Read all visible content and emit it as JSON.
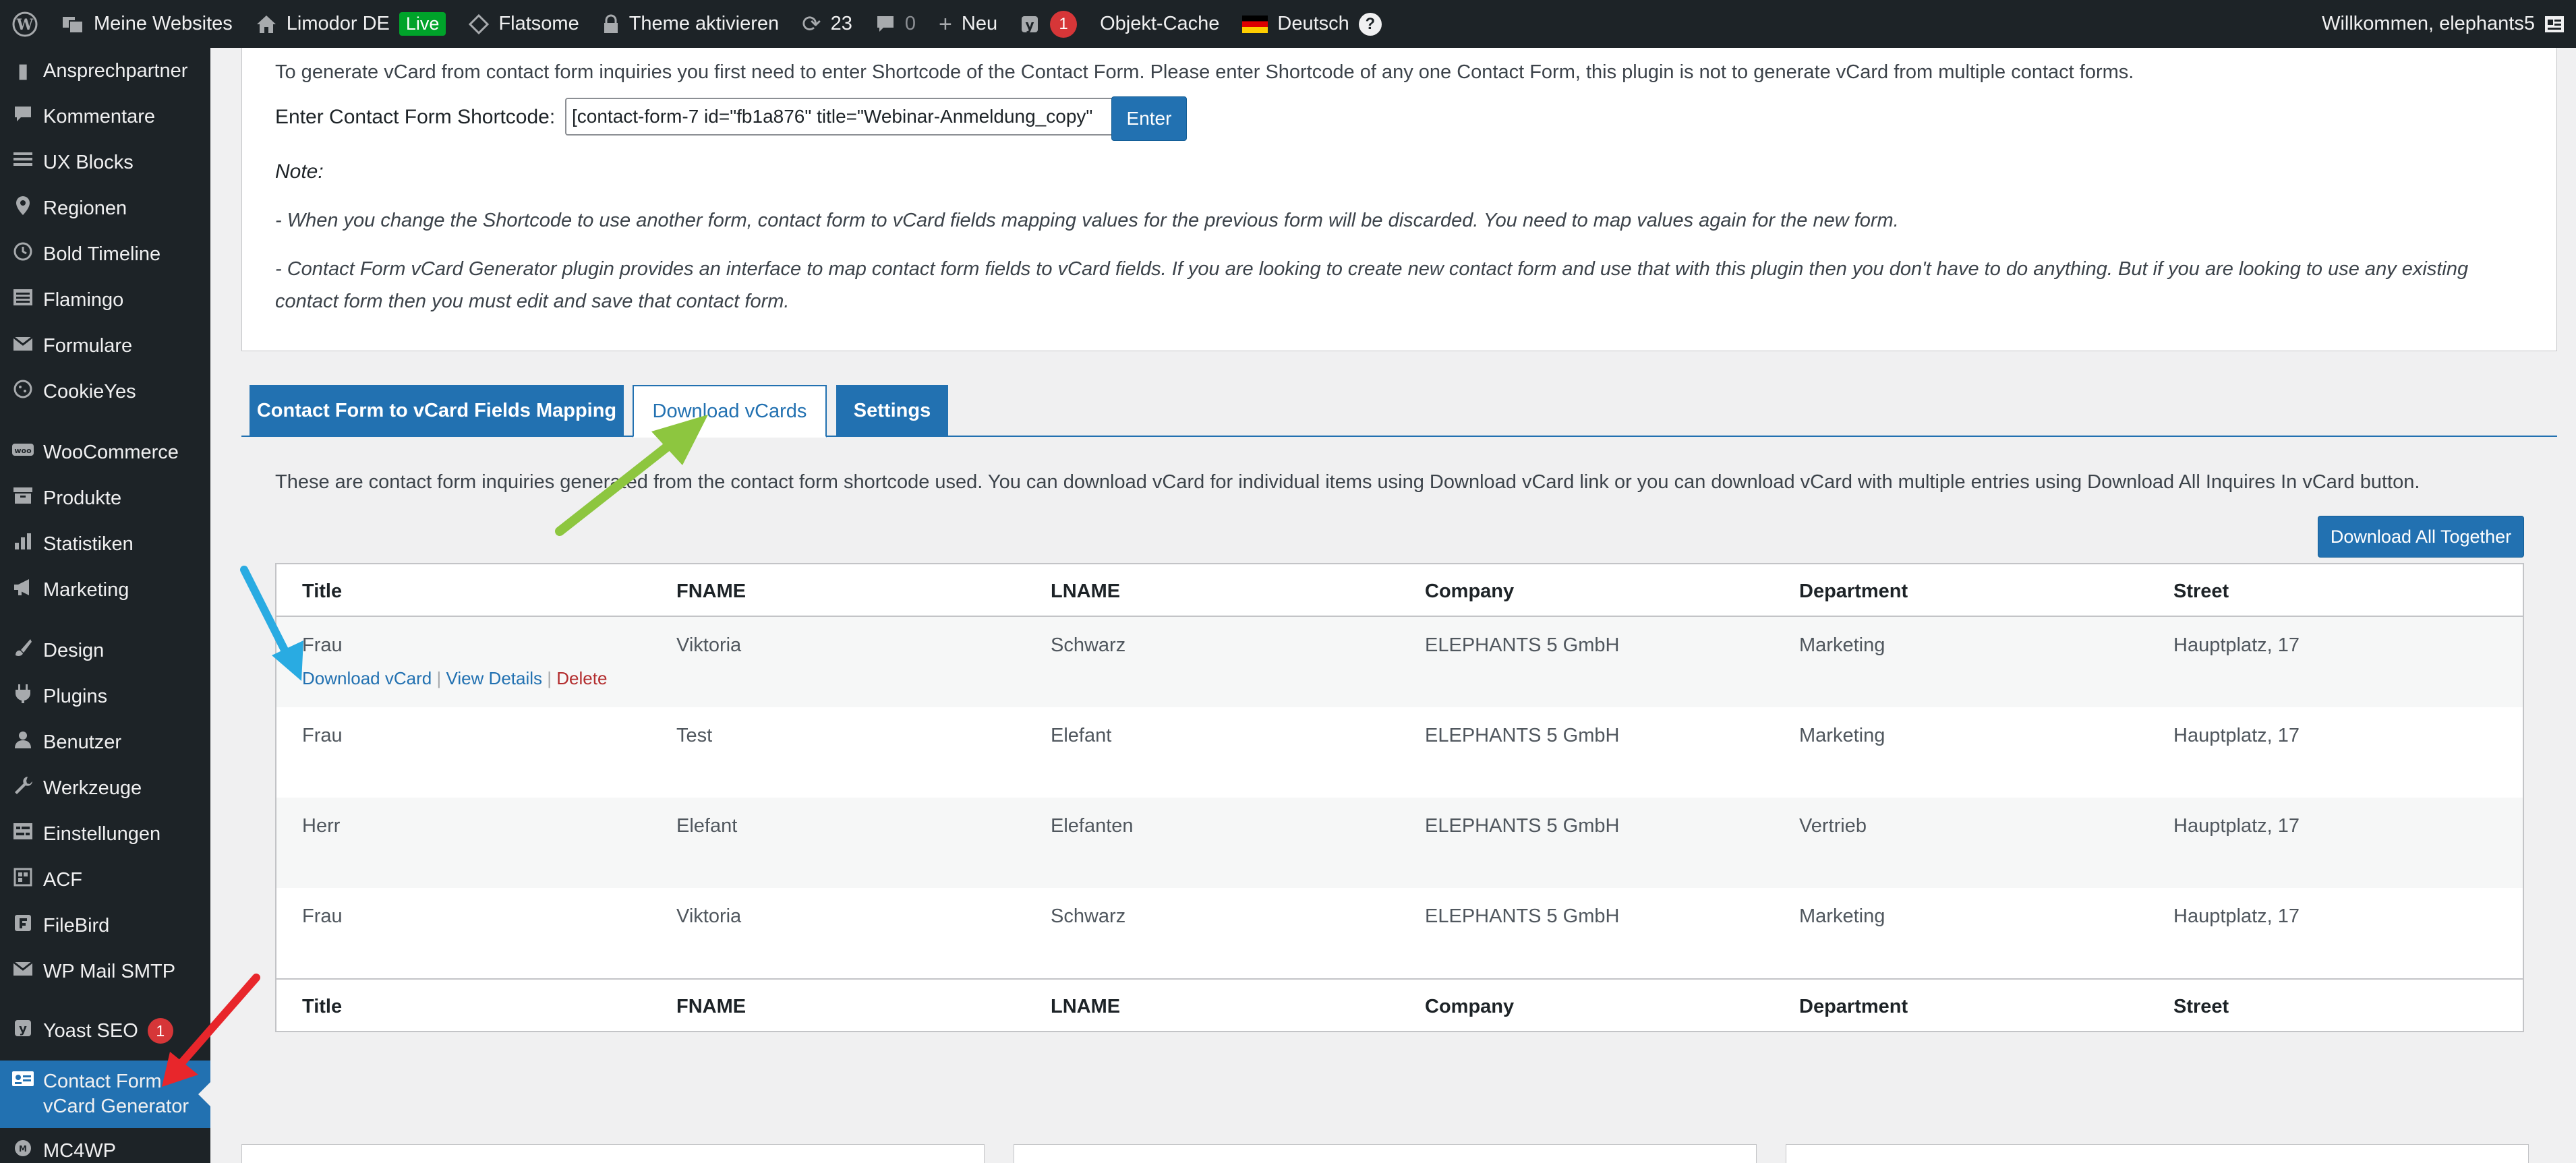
{
  "adminbar": {
    "sites": "Meine Websites",
    "site_name": "Limodor DE",
    "live": "Live",
    "theme": "Flatsome",
    "theme_activate": "Theme aktivieren",
    "updates": "23",
    "comments": "0",
    "new": "Neu",
    "yoast_count": "1",
    "object_cache": "Objekt-Cache",
    "language": "Deutsch",
    "help": "?",
    "welcome": "Willkommen, elephants5"
  },
  "sidebar": {
    "items": [
      {
        "icon": "contacts-icon",
        "label": "Ansprechpartner"
      },
      {
        "icon": "comments-icon",
        "label": "Kommentare"
      },
      {
        "icon": "ux-blocks-icon",
        "label": "UX Blocks"
      },
      {
        "icon": "location-icon",
        "label": "Regionen"
      },
      {
        "icon": "clock-icon",
        "label": "Bold Timeline"
      },
      {
        "icon": "flamingo-icon",
        "label": "Flamingo"
      },
      {
        "icon": "mail-icon",
        "label": "Formulare"
      },
      {
        "icon": "cookieyes-icon",
        "label": "CookieYes"
      },
      {
        "icon": "woocommerce-icon",
        "label": "WooCommerce"
      },
      {
        "icon": "archive-icon",
        "label": "Produkte"
      },
      {
        "icon": "chart-icon",
        "label": "Statistiken"
      },
      {
        "icon": "megaphone-icon",
        "label": "Marketing"
      },
      {
        "icon": "brush-icon",
        "label": "Design"
      },
      {
        "icon": "plugin-icon",
        "label": "Plugins"
      },
      {
        "icon": "user-icon",
        "label": "Benutzer"
      },
      {
        "icon": "wrench-icon",
        "label": "Werkzeuge"
      },
      {
        "icon": "settings-icon",
        "label": "Einstellungen"
      },
      {
        "icon": "acf-icon",
        "label": "ACF"
      },
      {
        "icon": "filebird-icon",
        "label": "FileBird"
      },
      {
        "icon": "mail-smtp-icon",
        "label": "WP Mail SMTP"
      },
      {
        "icon": "yoast-icon",
        "label": "Yoast SEO",
        "badge": "1"
      },
      {
        "icon": "vcard-icon",
        "label": "Contact Form vCard Generator"
      },
      {
        "icon": "mc4wp-icon",
        "label": "MC4WP"
      }
    ]
  },
  "info": {
    "text": "To generate vCard from contact form inquiries you first need to enter Shortcode of the Contact Form. Please enter Shortcode of any one Contact Form, this plugin is not to generate vCard from multiple contact forms.",
    "shortcode_label": "Enter Contact Form Shortcode:",
    "shortcode_value": "[contact-form-7 id=\"fb1a876\" title=\"Webinar-Anmeldung_copy\"",
    "enter_button": "Enter",
    "note_heading": "Note:",
    "note_1": "- When you change the Shortcode to use another form, contact form to vCard fields mapping values for the previous form will be discarded. You need to map values again for the new form.",
    "note_2": "- Contact Form vCard Generator plugin provides an interface to map contact form fields to vCard fields. If you are looking to create new contact form and use that with this plugin then you don't have to do anything. But if you are looking to use any existing contact form then you must edit and save that contact form."
  },
  "tabs": [
    {
      "label": "Contact Form to vCard Fields Mapping",
      "active": false
    },
    {
      "label": "Download vCards",
      "active": true
    },
    {
      "label": "Settings",
      "active": false
    }
  ],
  "download_tab": {
    "description": "These are contact form inquiries generated from the contact form shortcode used. You can download vCard for individual items using Download vCard link or you can download vCard with multiple entries using Download All Inquires In vCard button.",
    "download_all": "Download All Together"
  },
  "table": {
    "columns": [
      "Title",
      "FNAME",
      "LNAME",
      "Company",
      "Department",
      "Street"
    ],
    "rows": [
      [
        "Frau",
        "Viktoria",
        "Schwarz",
        "ELEPHANTS 5 GmbH",
        "Marketing",
        "Hauptplatz, 17"
      ],
      [
        "Frau",
        "Test",
        "Elefant",
        "ELEPHANTS 5 GmbH",
        "Marketing",
        "Hauptplatz, 17"
      ],
      [
        "Herr",
        "Elefant",
        "Elefanten",
        "ELEPHANTS 5 GmbH",
        "Vertrieb",
        "Hauptplatz, 17"
      ],
      [
        "Frau",
        "Viktoria",
        "Schwarz",
        "ELEPHANTS 5 GmbH",
        "Marketing",
        "Hauptplatz, 17"
      ]
    ],
    "row_actions": {
      "download": "Download vCard",
      "view": "View Details",
      "delete": "Delete",
      "sep": "|"
    }
  },
  "colors": {
    "adminbar_bg": "#1d2327",
    "primary_blue": "#2271b1",
    "delete_red": "#b32d2e",
    "annotation_green": "#8dc63f",
    "annotation_blue": "#29abe2",
    "annotation_red": "#e8262b"
  }
}
